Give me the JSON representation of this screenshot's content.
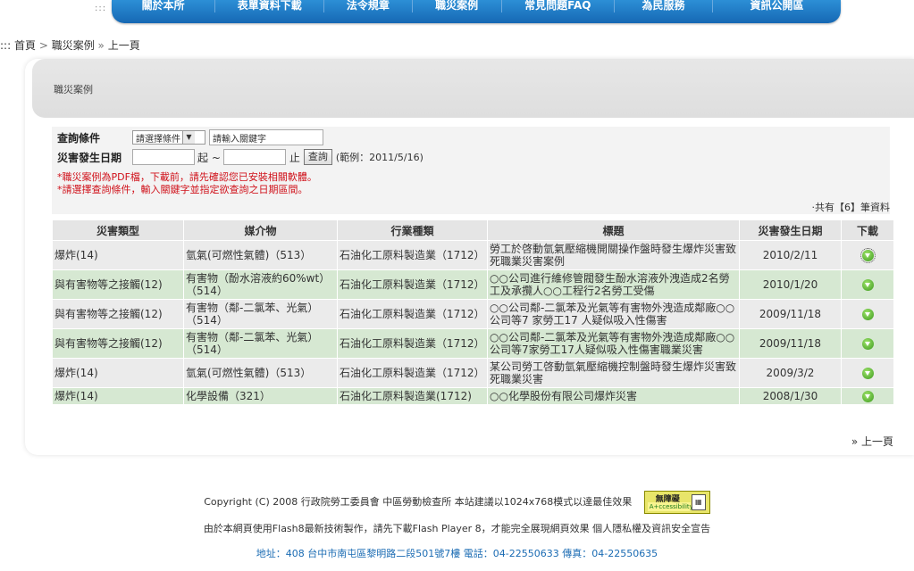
{
  "nav": {
    "dots": ":::",
    "items": [
      "關於本所",
      "表單資料下載",
      "法令規章",
      "職災案例",
      "常見問題FAQ",
      "為民服務",
      "資訊公開區"
    ]
  },
  "breadcrumb": {
    "prefix": ":::",
    "home": "首頁",
    "sep": ">",
    "current": "職災案例",
    "sep2": "»",
    "back": "上一頁"
  },
  "panel": {
    "title": "職災案例"
  },
  "query": {
    "cond_label": "查詢條件",
    "select_value": "請選擇條件",
    "keyword_value": "請輸入關鍵字",
    "date_label": "災害發生日期",
    "from_text": "起 ~",
    "to_text": "止",
    "button": "查詢",
    "example": "(範例：2011/5/16)",
    "note1": "*職災案例為PDF檔，下載前，請先確認您已安裝相關軟體。",
    "note2": "*請選擇查詢條件，輸入關鍵字並指定欲查詢之日期區間。",
    "total": "‧共有【6】筆資料"
  },
  "table": {
    "headers": [
      "災害類型",
      "媒介物",
      "行業種類",
      "標題",
      "災害發生日期",
      "下載"
    ],
    "rows": [
      {
        "type": "爆炸(14)",
        "medium": "氫氣(可燃性氣體)（513）",
        "industry": "石油化工原料製造業（1712）",
        "title": "勞工於啓動氫氣壓縮機開關操作盤時發生爆炸災害致死職業災害案例",
        "date": "2010/2/11"
      },
      {
        "type": "與有害物等之接觸(12)",
        "medium": "有害物（酚水溶液約60%wt）（514）",
        "industry": "石油化工原料製造業（1712）",
        "title": "○○公司進行維修管閥發生酚水溶液外洩造成2名勞工及承攬人○○工程行2名勞工受傷",
        "date": "2010/1/20"
      },
      {
        "type": "與有害物等之接觸(12)",
        "medium": "有害物（鄰-二氯苯、光氣）（514）",
        "industry": "石油化工原料製造業（1712）",
        "title": "○○公司鄰-二氯苯及光氣等有害物外洩造成鄰廠○○公司等7 家勞工17 人疑似吸入性傷害",
        "date": "2009/11/18"
      },
      {
        "type": "與有害物等之接觸(12)",
        "medium": "有害物（鄰-二氯苯、光氣）（514）",
        "industry": "石油化工原料製造業（1712）",
        "title": "○○公司鄰-二氯苯及光氣等有害物外洩造成鄰廠○○公司等7家勞工17人疑似吸入性傷害職業災害",
        "date": "2009/11/18"
      },
      {
        "type": "爆炸(14)",
        "medium": "氫氣(可燃性氣體)（513）",
        "industry": "石油化工原料製造業（1712）",
        "title": "某公司勞工啓動氫氣壓縮機控制盤時發生爆炸災害致死職業災害",
        "date": "2009/3/2"
      },
      {
        "type": "爆炸(14)",
        "medium": "化學設備（321）",
        "industry": "石油化工原料製造業(1712)",
        "title": "○○化學股份有限公司爆炸災害",
        "date": "2008/1/30"
      }
    ]
  },
  "back_link": "» 上一頁",
  "footer": {
    "copyright": "Copyright (C) 2008 行政院勞工委員會 中區勞動檢查所 本站建議以1024x768模式以達最佳效果",
    "badge_top": "無障礙",
    "badge_bottom": "A+ccessibility",
    "flash_note": "由於本網頁使用Flash8最新技術製作，請先下載Flash Player 8，才能完全展現網頁效果 個人隱私權及資訊安全宣告",
    "address": "地址：408 台中市南屯區黎明路二段501號7樓 電話：04-22550633 傳真：04-22550635"
  }
}
